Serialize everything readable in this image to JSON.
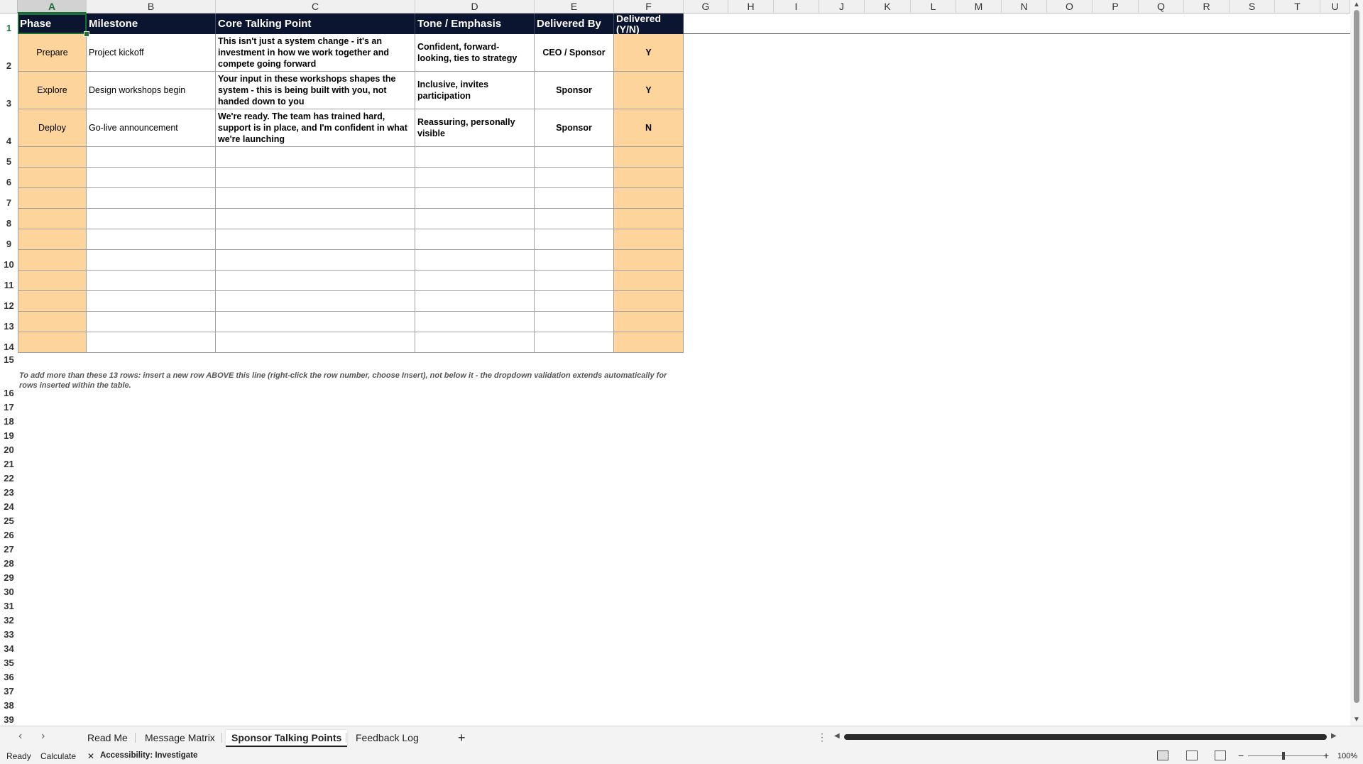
{
  "columns": [
    "A",
    "B",
    "C",
    "D",
    "E",
    "F",
    "G",
    "H",
    "I",
    "J",
    "K",
    "L",
    "M",
    "N",
    "O",
    "P",
    "Q",
    "R",
    "S",
    "T",
    "U"
  ],
  "row_numbers": [
    "1",
    "2",
    "3",
    "4",
    "5",
    "6",
    "7",
    "8",
    "9",
    "10",
    "11",
    "12",
    "13",
    "14",
    "15",
    "16",
    "17",
    "18",
    "19",
    "20",
    "21",
    "22",
    "23",
    "24",
    "25",
    "26",
    "27",
    "28",
    "29",
    "30",
    "31",
    "32",
    "33",
    "34",
    "35",
    "36",
    "37",
    "38",
    "39"
  ],
  "table": {
    "headers": [
      "Phase",
      "Milestone",
      "Core Talking Point",
      "Tone / Emphasis",
      "Delivered By",
      "Delivered (Y/N)"
    ],
    "rows": [
      [
        "Prepare",
        "Project kickoff",
        "This isn't just a system change - it's an investment in how we work together and compete going forward",
        "Confident, forward-looking, ties to strategy",
        "CEO / Sponsor",
        "Y"
      ],
      [
        "Explore",
        "Design workshops begin",
        "Your input in these workshops shapes the system - this is being built with you, not handed down to you",
        "Inclusive, invites participation",
        "Sponsor",
        "Y"
      ],
      [
        "Deploy",
        "Go-live announcement",
        "We're ready. The team has trained hard, support is in place, and I'm confident in what we're launching",
        "Reassuring, personally visible",
        "Sponsor",
        "N"
      ]
    ]
  },
  "note": "To add more than these 13 rows: insert a new row ABOVE this line (right-click the row number, choose Insert), not below it - the dropdown validation extends automatically for rows inserted within the table.",
  "sheet_tabs": [
    "Read Me",
    "Message Matrix",
    "Sponsor Talking Points",
    "Feedback Log"
  ],
  "active_tab": "Sponsor Talking Points",
  "add_sheet_label": "+",
  "status": {
    "ready": "Ready",
    "calculate": "Calculate",
    "accessibility": "Accessibility: Investigate",
    "zoom": "100%"
  },
  "colors": {
    "header_bg": "#0b1530",
    "peach": "#fdd59c",
    "select_green": "#1e6e3a"
  }
}
